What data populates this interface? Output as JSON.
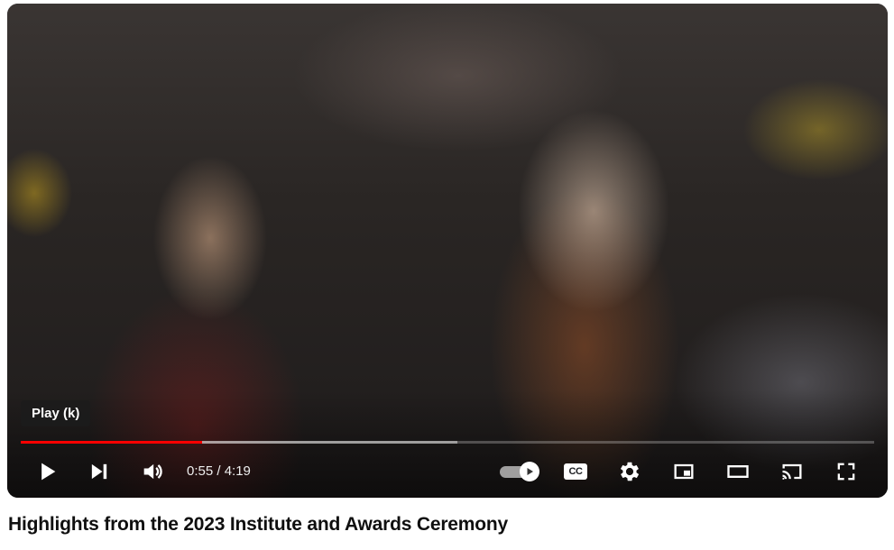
{
  "player": {
    "tooltip": "Play (k)",
    "time": "0:55 / 4:19",
    "progress_played": 0.212,
    "progress_loaded": 0.512,
    "accent_color": "#ff0000",
    "cc_label": "CC",
    "icons": {
      "play": "play-icon",
      "next": "next-icon",
      "volume": "volume-icon",
      "autoplay": "autoplay-toggle-icon",
      "captions": "cc-icon",
      "settings": "gear-icon",
      "miniplayer": "miniplayer-icon",
      "theater": "theater-mode-icon",
      "cast": "cast-icon",
      "fullscreen": "fullscreen-icon"
    }
  },
  "video": {
    "title": "Highlights from the 2023 Institute and Awards Ceremony"
  }
}
